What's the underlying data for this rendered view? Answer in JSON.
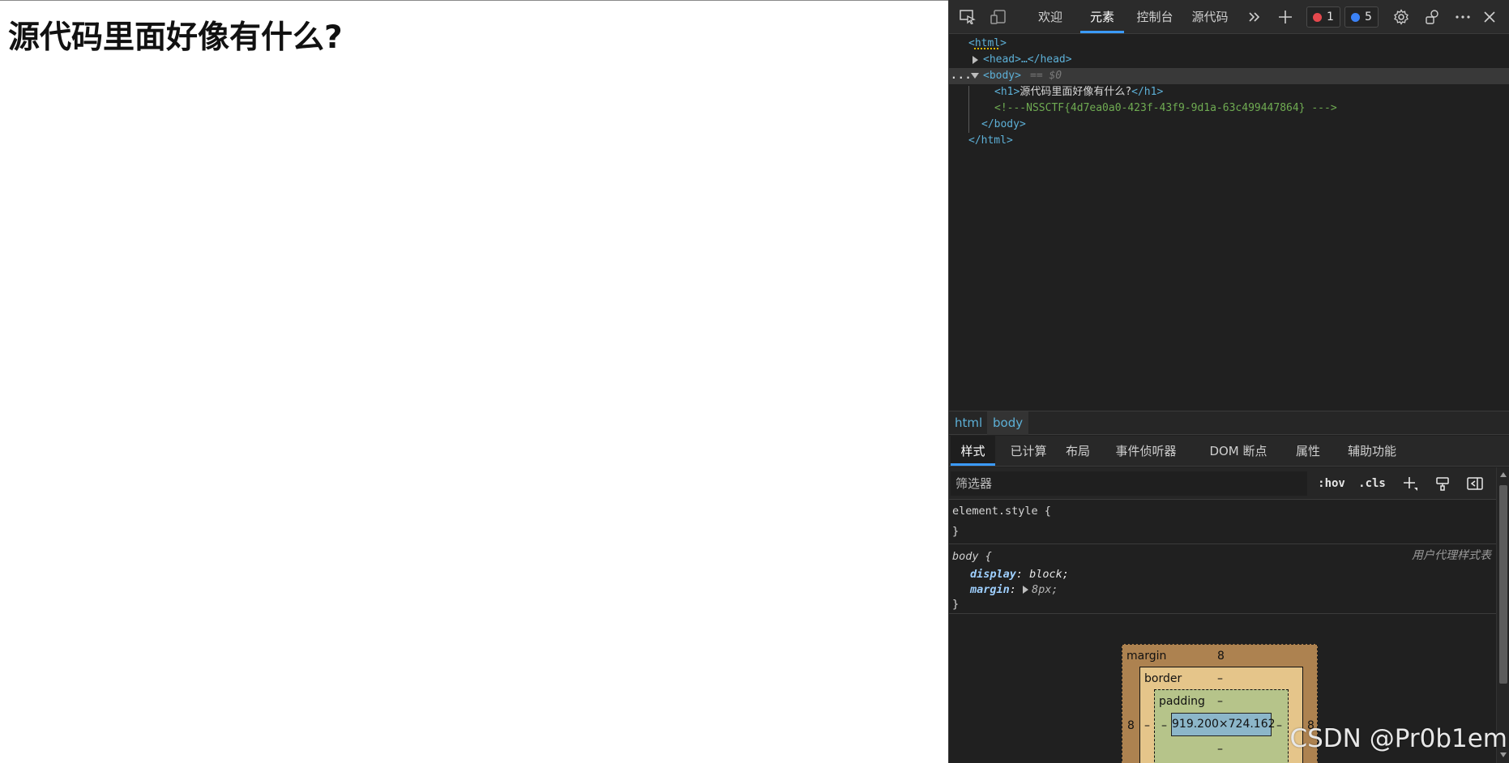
{
  "page": {
    "heading": "源代码里面好像有什么?"
  },
  "devtools": {
    "toolbar": {
      "tabs": [
        "欢迎",
        "元素",
        "控制台",
        "源代码"
      ],
      "error_count": "1",
      "message_count": "5",
      "icons": [
        "inspect-icon",
        "device-toggle-icon",
        "more-tabs-icon",
        "add-tab-icon",
        "settings-icon",
        "connection-icon",
        "more-options-icon",
        "close-icon"
      ]
    },
    "dom": {
      "html_open": "<html>",
      "head": "<head>…</head>",
      "ellipsis": "...",
      "body_open": "<body>",
      "body_eq": "== $0",
      "h1_open": "<h1>",
      "h1_text": "源代码里面好像有什么?",
      "h1_close": "</h1>",
      "comment": "<!---NSSCTF{4d7ea0a0-423f-43f9-9d1a-63c499447864} --->",
      "body_close": "</body>",
      "html_close": "</html>"
    },
    "breadcrumbs": [
      "html",
      "body"
    ],
    "panel_tabs": [
      "样式",
      "已计算",
      "布局",
      "事件侦听器",
      "DOM 断点",
      "属性",
      "辅助功能"
    ],
    "filter": {
      "placeholder": "筛选器",
      "hov": ":hov",
      "cls": ".cls"
    },
    "styles": {
      "element_selector": "element.style {",
      "close_brace": "}",
      "body_selector": "body {",
      "source": "用户代理样式表",
      "props": [
        {
          "name": "display",
          "value": "block;"
        },
        {
          "name": "margin",
          "value": "8px;"
        }
      ]
    },
    "box_model": {
      "margin_label": "margin",
      "margin_top": "8",
      "margin_left": "8",
      "margin_right": "8",
      "border_label": "border",
      "border_top": "–",
      "border_left": "–",
      "border_right": "–",
      "padding_label": "padding",
      "padding_top": "–",
      "padding_left": "–",
      "padding_right": "–",
      "padding_bottom": "–",
      "content": "919.200×724.162"
    }
  },
  "watermark": "CSDN @Pr0b1em"
}
